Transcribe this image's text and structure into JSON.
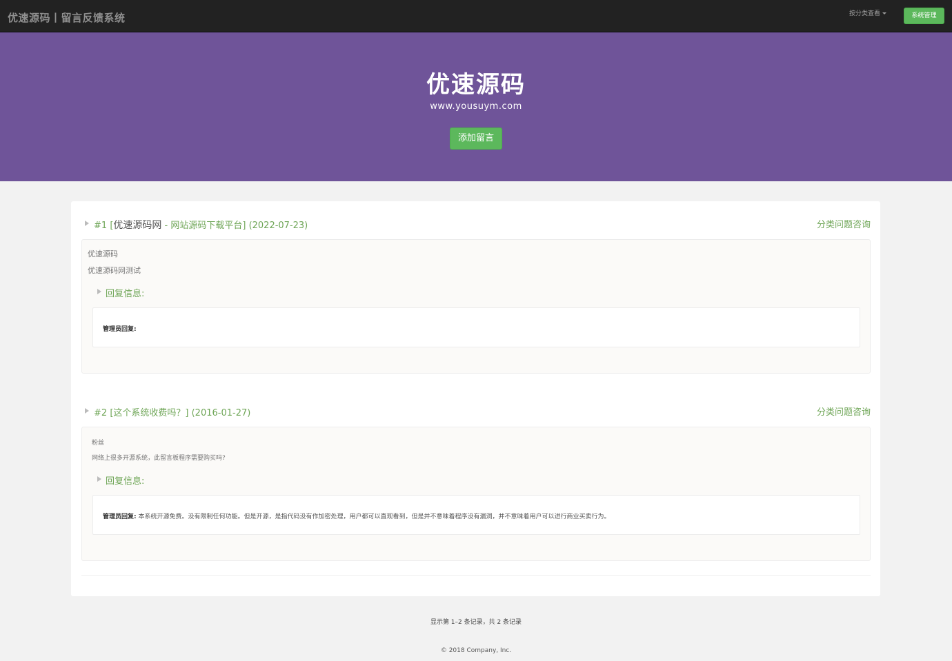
{
  "navbar": {
    "brand": "优速源码丨留言反馈系统",
    "category_dropdown": "按分类查看",
    "admin_button": "系统管理"
  },
  "hero": {
    "title": "优速源码",
    "url": "www.yousuym.com",
    "add_button": "添加留言"
  },
  "messages": [
    {
      "number": "#1",
      "title_prefix": "[",
      "title_dark": "优速源码网",
      "title_rest": " - 网站源码下载平台]",
      "date": "(2022-07-23)",
      "category": "分类问题咨询",
      "author": "优速源码",
      "content": "优速源码网测试",
      "reply_label": "回复信息:",
      "admin_label": "管理员回复:",
      "reply": ""
    },
    {
      "number": "#2",
      "title_prefix": "[",
      "title_dark": "",
      "title_rest": "这个系统收费吗？]",
      "date": "(2016-01-27)",
      "category": "分类问题咨询",
      "author": "粉丝",
      "content": "网络上很多开源系统，此留言板程序需要购买吗?",
      "reply_label": "回复信息:",
      "admin_label": "管理员回复:",
      "reply": "本系统开源免费。没有限制任何功能。但是开源，是指代码没有作加密处理，用户都可以直观看到，但是并不意味着程序没有漏洞，并不意味着用户可以进行商业买卖行为。"
    }
  ],
  "pagination": {
    "summary": "显示第 1–2 条记录，共 2 条记录"
  },
  "footer": {
    "copyright": "© 2018 Company, Inc."
  }
}
